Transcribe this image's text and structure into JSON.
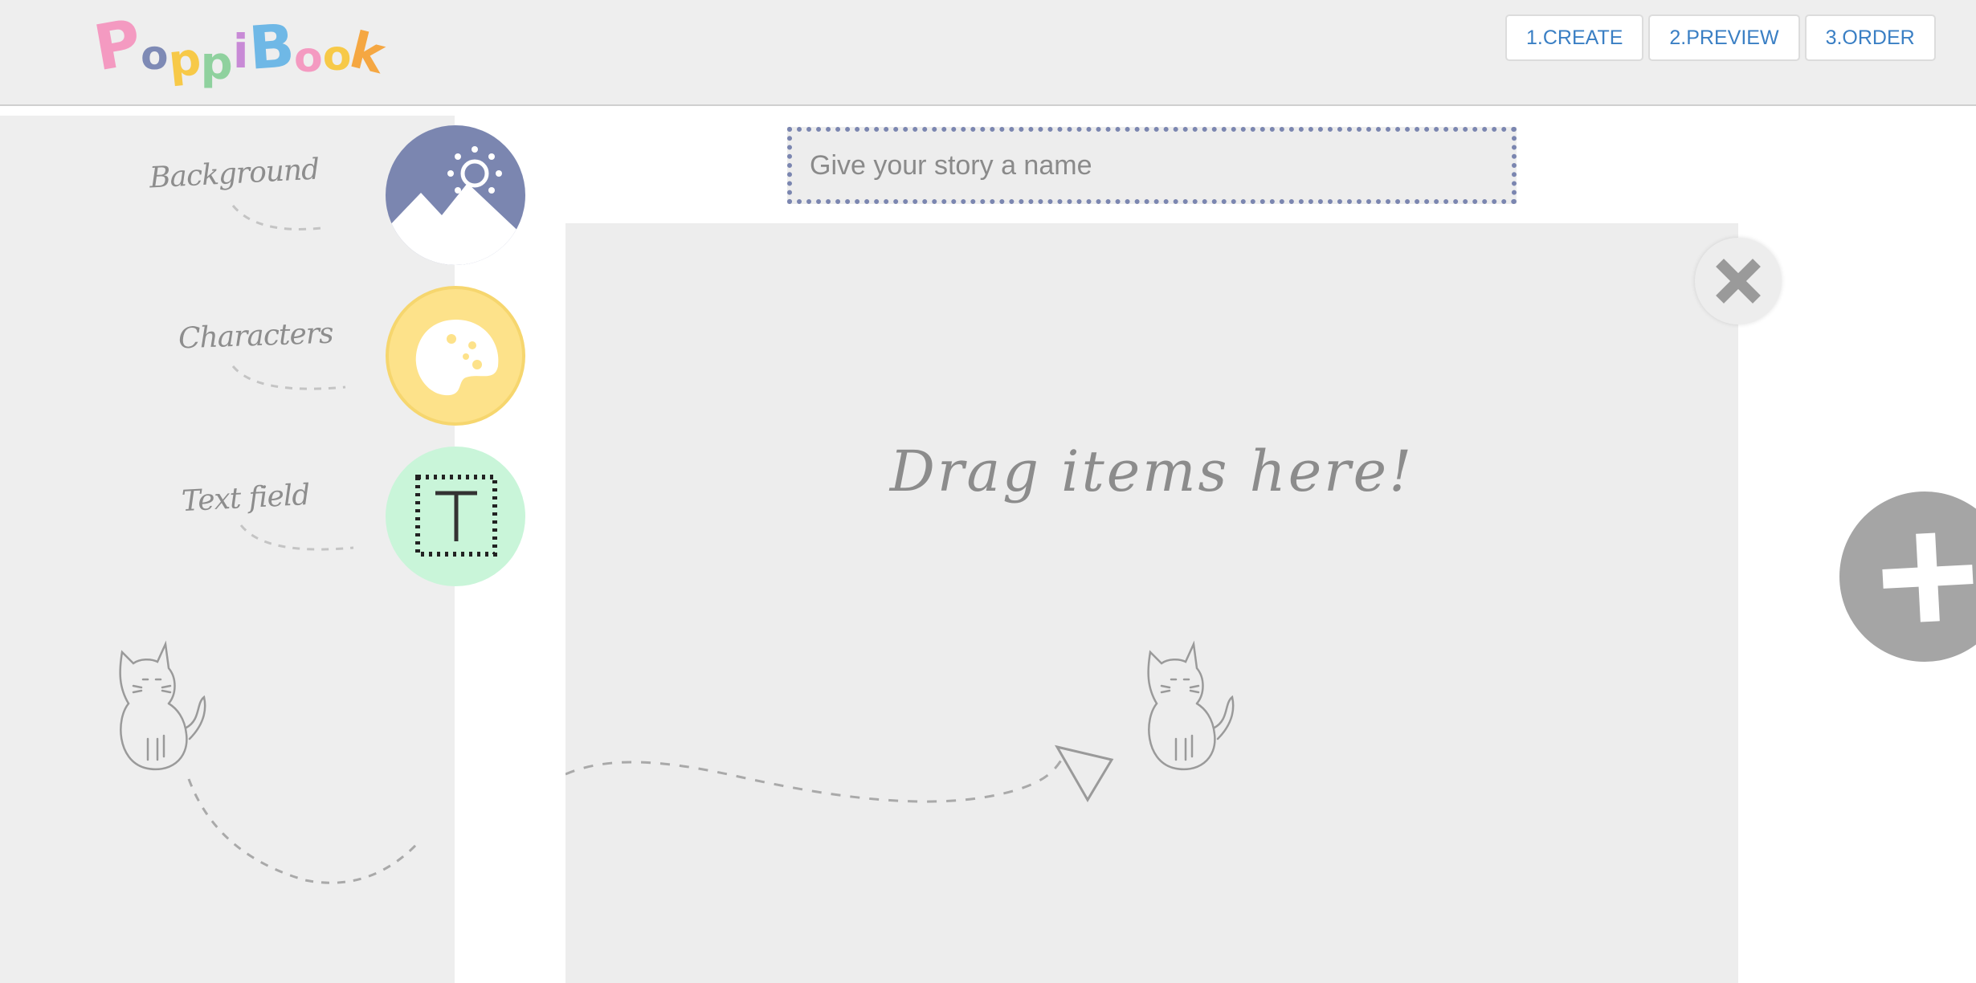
{
  "header": {
    "logo_letters": [
      {
        "ch": "P",
        "color": "#f49ac1"
      },
      {
        "ch": "o",
        "color": "#7e8ab5"
      },
      {
        "ch": "p",
        "color": "#f7c948"
      },
      {
        "ch": "p",
        "color": "#8fd19e"
      },
      {
        "ch": "i",
        "color": "#c88ad6"
      },
      {
        "ch": "B",
        "color": "#6fb8e6"
      },
      {
        "ch": "o",
        "color": "#f49ac1"
      },
      {
        "ch": "o",
        "color": "#f7c948"
      },
      {
        "ch": "k",
        "color": "#f5a742"
      }
    ],
    "nav": [
      "1.CREATE",
      "2.PREVIEW",
      "3.ORDER"
    ]
  },
  "sidebar": {
    "tools": [
      {
        "label": "Background",
        "icon": "landscape-icon",
        "color": "#7b86b0"
      },
      {
        "label": "Characters",
        "icon": "palette-icon",
        "color": "#fde28a"
      },
      {
        "label": "Text field",
        "icon": "text-field-icon",
        "color": "#c9f5d9"
      }
    ]
  },
  "editor": {
    "title_placeholder": "Give your story a name",
    "drop_hint": "Drag items here!"
  },
  "colors": {
    "accent": "#7b86b0",
    "nav_text": "#3a7fc4",
    "add_button": "#a5a5a5"
  },
  "icons": {
    "close": "close-icon",
    "add": "plus-icon",
    "cat": "cat-doodle-icon"
  }
}
